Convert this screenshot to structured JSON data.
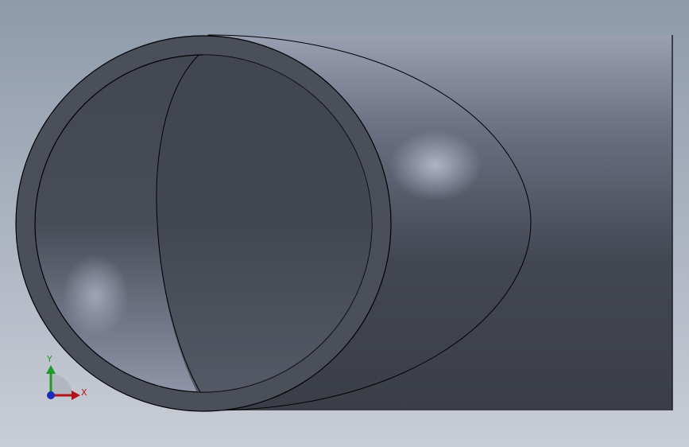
{
  "viewport": {
    "background_top": "#8e9aaa",
    "background_bottom": "#c9cdd6",
    "model": {
      "type": "pipe-elbow",
      "face_color": "#3f434d",
      "highlight_color": "#a9aec0",
      "edge_color": "#000000"
    }
  },
  "triad": {
    "x_label": "X",
    "y_label": "Y",
    "x_color": "#b3141b",
    "y_color": "#1d9a2a",
    "z_color": "#1c2cb8"
  }
}
